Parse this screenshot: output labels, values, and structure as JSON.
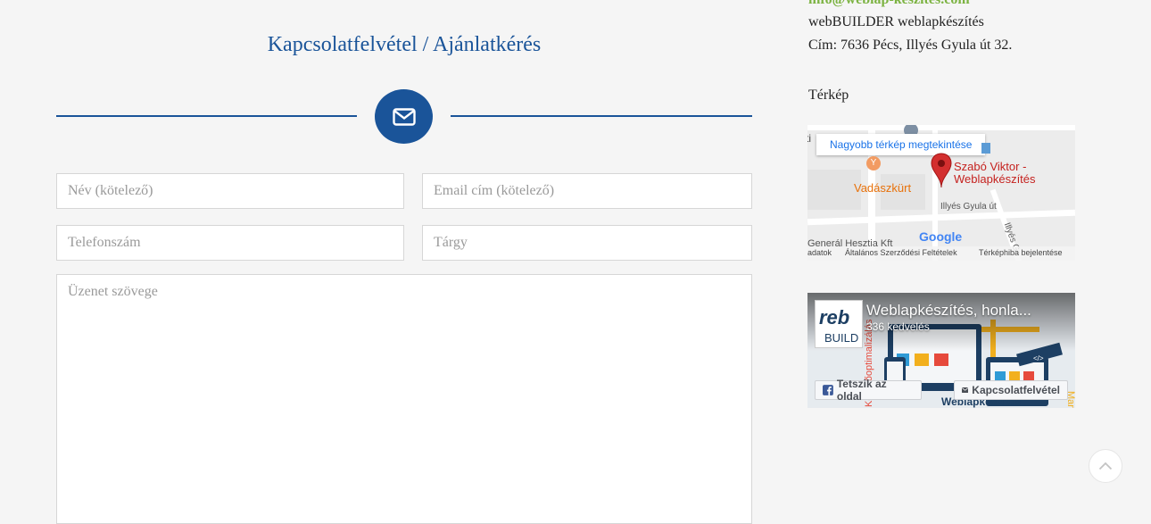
{
  "form": {
    "title": "Kapcsolatfelvétel / Ajánlatkérés",
    "name_placeholder": "Név (kötelező)",
    "email_placeholder": "Email cím (kötelező)",
    "phone_placeholder": "Telefonszám",
    "subject_placeholder": "Tárgy",
    "message_placeholder": "Üzenet szövege"
  },
  "sidebar": {
    "email": "info@weblap-keszites.com",
    "company": "webBUILDER weblapkészítés",
    "address": "Cím: 7636 Pécs, Illyés Gyula út 32.",
    "map_heading": "Térkép"
  },
  "map": {
    "larger_link": "Nagyobb térkép megtekintése",
    "place_name_line1": "Szabó Viktor -",
    "place_name_line2": "Weblapkészítés",
    "poi_label": "Vadászkürt",
    "street_label": "Illyés Gyula út",
    "street_label_2": "Illyés G",
    "bottom_label": "Generál Hesztia Kft",
    "google": "Google",
    "footer_data": "adatok",
    "footer_terms": "Általános Szerződési Feltételek",
    "footer_report": "Térképhiba bejelentése",
    "colors": {
      "pin": "#d32f2f",
      "place_text": "#c5221f",
      "poi_text": "#e8710a"
    }
  },
  "facebook": {
    "page_name": "Weblapkészítés, honla...",
    "likes": "336 kedvelés",
    "logo_text_top": "reb",
    "logo_text_bottom": "BUILD",
    "like_button": "Tetszik az oldal",
    "contact_button": "Kapcsolatfelvétel",
    "cover_side_left": "Keresőoptimalizálás",
    "cover_side_right": "Marketing",
    "cover_bottom": "Weblapkészítés",
    "cover_tag": "</>",
    "colors": {
      "brand": "#3b5998"
    }
  },
  "theme": {
    "primary": "#1a5499",
    "accent_green": "#7cb342"
  },
  "icons": {
    "divider": "envelope-icon",
    "back_to_top": "chevron-up-icon",
    "map_pin": "map-pin-icon"
  }
}
